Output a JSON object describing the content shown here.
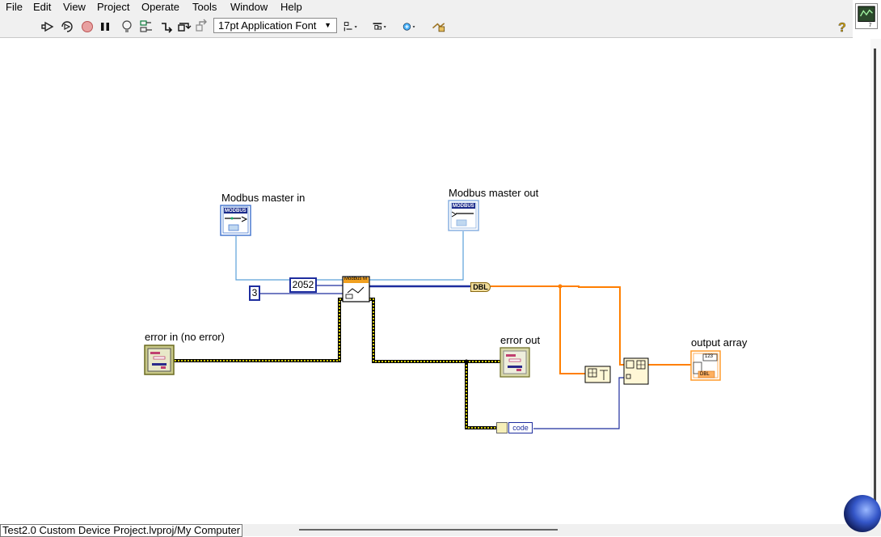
{
  "menu": [
    "File",
    "Edit",
    "View",
    "Project",
    "Operate",
    "Tools",
    "Window",
    "Help"
  ],
  "toolbar": {
    "font": "17pt Application Font",
    "icons": [
      "run-arrow-icon",
      "run-continuously-icon",
      "abort-icon",
      "pause-icon",
      "highlight-execution-icon",
      "retain-wire-values-icon",
      "step-into-icon",
      "step-over-icon",
      "step-out-icon",
      "align-objects-icon",
      "distribute-objects-icon",
      "reorder-icon",
      "cleanup-diagram-icon",
      "help-icon"
    ]
  },
  "diagram": {
    "labels": {
      "master_in": "Modbus master in",
      "master_out": "Modbus master out",
      "error_in": "error in (no error)",
      "error_out": "error out",
      "output_array": "output array"
    },
    "constants": {
      "address": "2052",
      "count": "3"
    },
    "dbl_label": "DBL",
    "code_label": "code",
    "modbus_badge": "MODBUS",
    "subvi_label": "Modbus M",
    "array_badge": "123",
    "array_type": "DBL"
  },
  "status": {
    "path": "Test2.0 Custom Device Project.lvproj/My Computer"
  },
  "colors": {
    "refnum_wire": "#5aa0d8",
    "int_wire": "#1e2d9e",
    "double_wire": "#ff7f00",
    "error_wire": "#999400"
  }
}
